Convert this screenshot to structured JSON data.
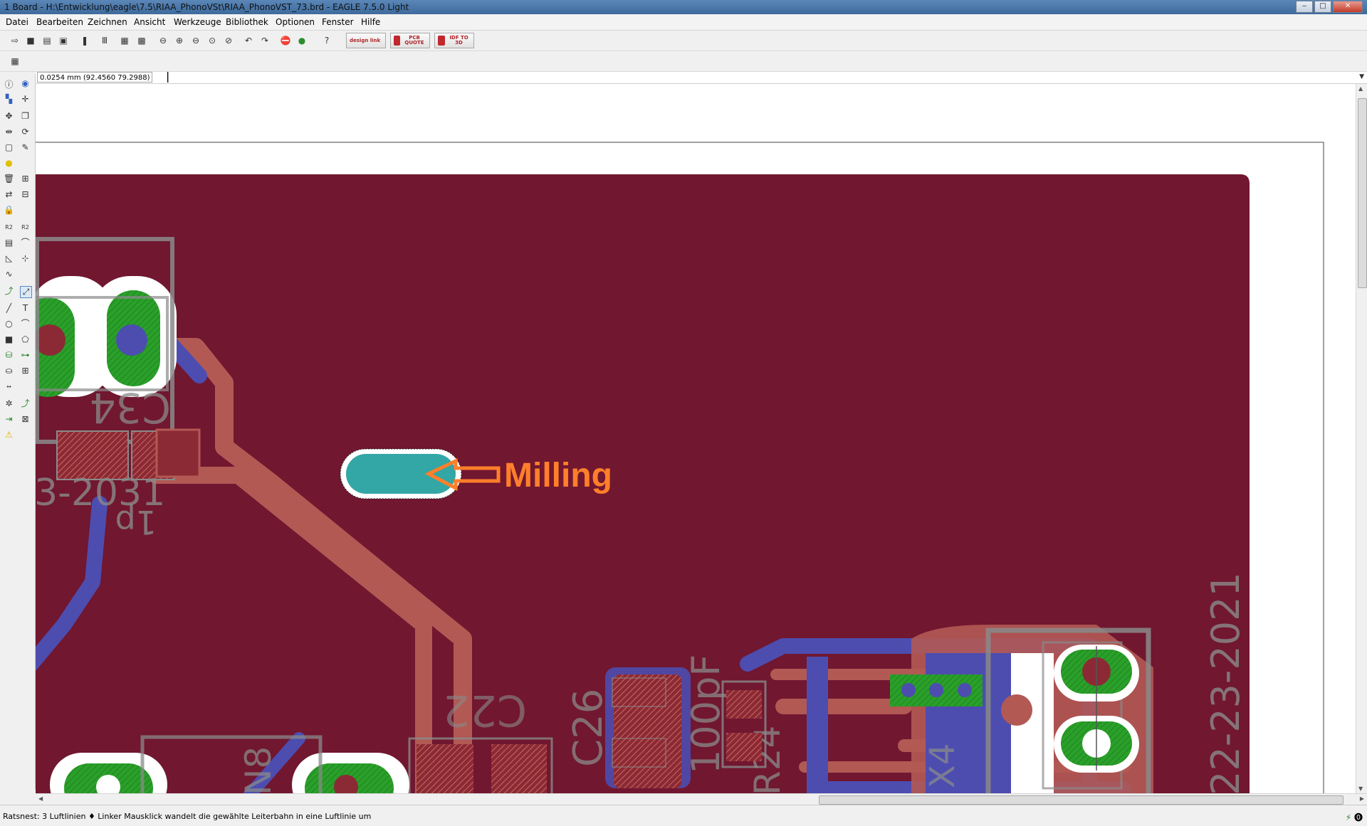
{
  "window": {
    "title": "1 Board - H:\\Entwicklung\\eagle\\7.5\\RIAA_PhonoVSt\\RIAA_PhonoVST_73.brd - EAGLE 7.5.0 Light",
    "min": "‒",
    "max": "□",
    "close": "✕"
  },
  "menu": [
    "Datei",
    "Bearbeiten",
    "Zeichnen",
    "Ansicht",
    "Werkzeuge",
    "Bibliothek",
    "Optionen",
    "Fenster",
    "Hilfe"
  ],
  "toolbar": {
    "icons": [
      "open-icon",
      "save-icon",
      "print-icon",
      "cam-icon",
      "script-icon",
      "ulp-icon",
      "layers-icon",
      "board-icon",
      "zoom-fit-icon",
      "zoom-in-icon",
      "zoom-out-icon",
      "zoom-redraw-icon",
      "zoom-select-icon",
      "undo-icon",
      "redo-icon",
      "stop-icon",
      "go-icon",
      "help-icon"
    ],
    "design_link": "design link",
    "pcb_quote": "PCB QUOTE",
    "idf_3d": "IDF TO 3D"
  },
  "command": {
    "coord": "0.0254 mm (92.4560 79.2988)",
    "value": ""
  },
  "board": {
    "annotation": "Milling",
    "date_text": "22-23-2021",
    "date_text_left": "3-2031",
    "labels": {
      "c34": "C34",
      "c22": "C22",
      "c26": "C26",
      "value_1p": "1p",
      "value_100pf": "100pF",
      "r24": "R24",
      "x4": "X4",
      "n8": "N8"
    },
    "colors": {
      "board": "#711730",
      "top_copper": "#b25954",
      "bottom_copper": "#4d4db0",
      "pad": "#2aa02a",
      "milling": "#33a6a6",
      "annotation": "#ff7f2a",
      "silk": "#8a8a8a"
    }
  },
  "status": {
    "text": "Ratsnest: 3 Luftlinien  ♦ Linker Mausklick wandelt die gewählte Leiterbahn in eine Luftlinie um"
  }
}
